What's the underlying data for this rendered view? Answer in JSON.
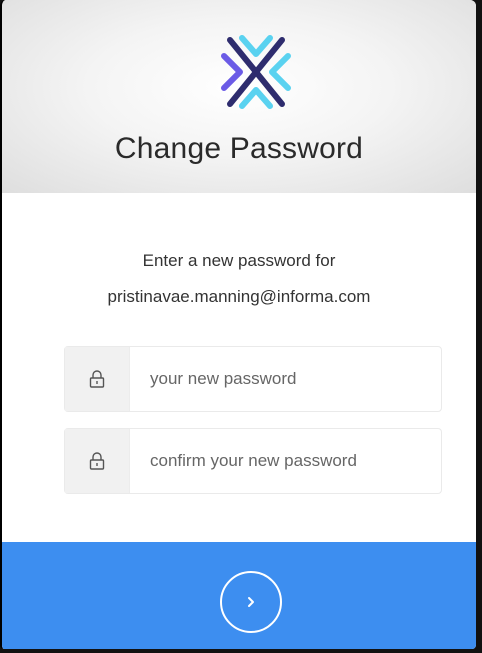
{
  "header": {
    "title": "Change Password",
    "logo_icon": "cross-arrows-logo"
  },
  "prompt": {
    "line1": "Enter a new password for",
    "email": "pristinavae.manning@informa.com"
  },
  "fields": [
    {
      "icon": "lock-icon",
      "placeholder": "your new password",
      "value": ""
    },
    {
      "icon": "lock-icon",
      "placeholder": "confirm your new password",
      "value": ""
    }
  ],
  "submit": {
    "icon": "chevron-right-icon"
  },
  "colors": {
    "accent": "#3d8ef0",
    "logo_dark": "#2e2c6e",
    "logo_purple": "#6b5be6",
    "logo_cyan": "#5ad2f0"
  }
}
